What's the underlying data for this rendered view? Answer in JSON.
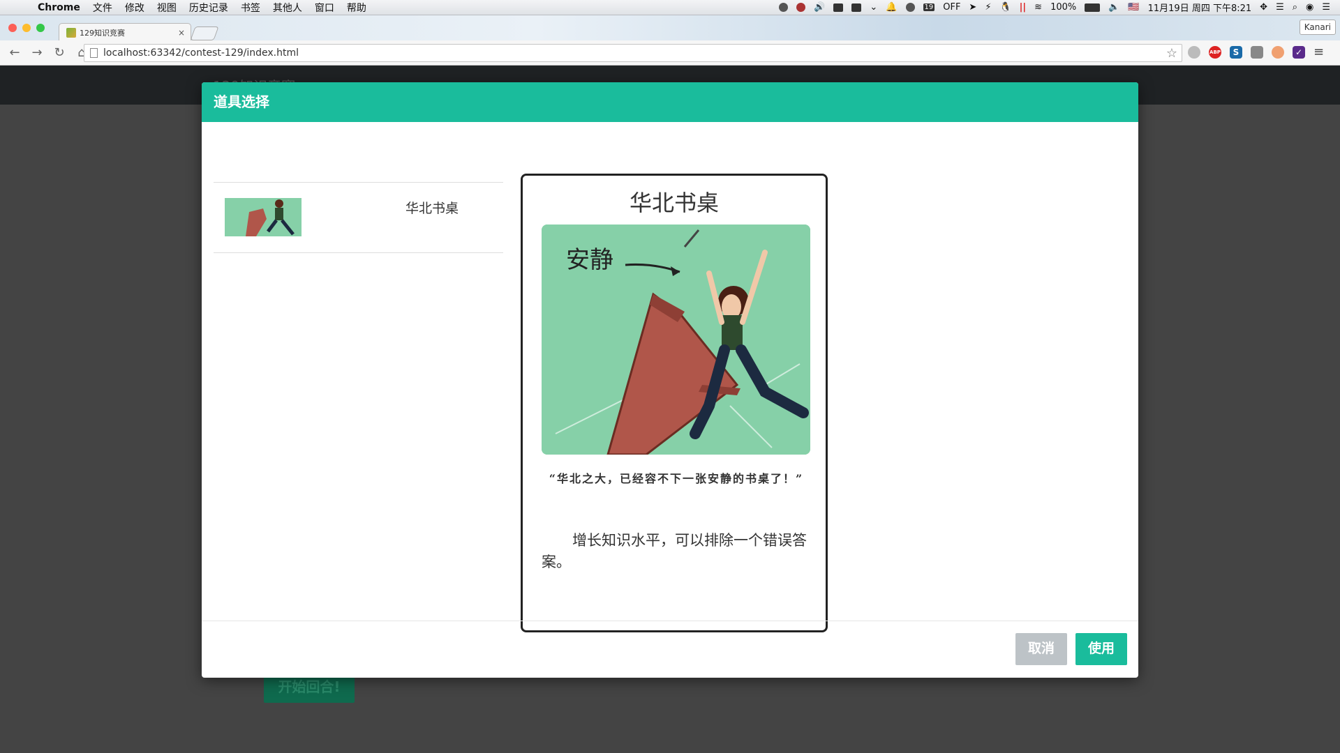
{
  "menubar": {
    "app_name": "Chrome",
    "menus": [
      "文件",
      "修改",
      "视图",
      "历史记录",
      "书签",
      "其他人",
      "窗口",
      "帮助"
    ],
    "status": {
      "badge": "19",
      "off": "OFF",
      "battery": "100%",
      "datetime": "11月19日 周四 下午8:21"
    }
  },
  "browser": {
    "tab_title": "129知识竞赛",
    "tab_close": "×",
    "profile": "Kanari",
    "url": "localhost:63342/contest-129/index.html"
  },
  "page": {
    "header_title": "129知识竞赛",
    "start_button": "开始回合!"
  },
  "modal": {
    "title": "道具选择",
    "items": [
      {
        "name": "华北书桌"
      }
    ],
    "card": {
      "title": "华北书桌",
      "image_caption": "安静",
      "quote": "“华北之大，已经容不下一张安静的书桌了！”",
      "description": "增长知识水平，可以排除一个错误答案。"
    },
    "cancel_label": "取消",
    "use_label": "使用"
  },
  "colors": {
    "accent": "#1abc9c",
    "cancel": "#bdc3c7",
    "image_bg": "#86d0a8"
  }
}
